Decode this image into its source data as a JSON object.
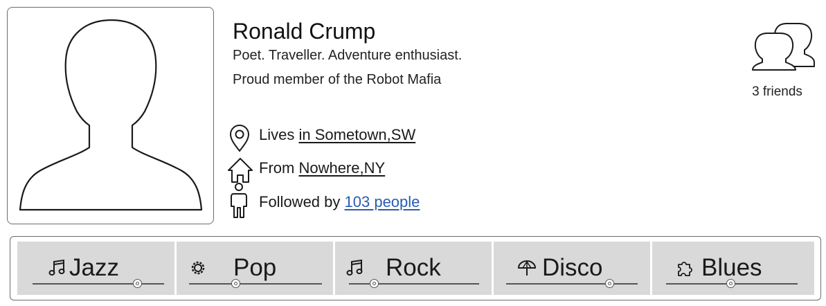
{
  "profile": {
    "name": "Ronald Crump",
    "bio_line1": "Poet. Traveller. Adventure enthusiast.",
    "bio_line2": "Proud member of the Robot Mafia",
    "lives_prefix": "Lives",
    "lives_link": "in Sometown,SW",
    "from_prefix": "From",
    "from_link": "Nowhere,NY",
    "followed_prefix": "Followed by",
    "followed_link": "103 people",
    "friends_label": "3 friends"
  },
  "icons": {
    "avatar": "avatar-silhouette-icon",
    "location": "location-pin-icon",
    "home": "house-icon",
    "person": "person-icon",
    "friends": "friends-icon"
  },
  "colors": {
    "link_blue": "#2a5db0",
    "tab_bg": "#d9d9d9"
  },
  "genres": [
    {
      "label": "Jazz",
      "icon": "music-note-icon",
      "slider": 0.82
    },
    {
      "label": "Pop",
      "icon": "gear-icon",
      "slider": 0.34
    },
    {
      "label": "Rock",
      "icon": "music-note-icon",
      "slider": 0.17
    },
    {
      "label": "Disco",
      "icon": "umbrella-icon",
      "slider": 0.81
    },
    {
      "label": "Blues",
      "icon": "puzzle-icon",
      "slider": 0.49
    }
  ]
}
